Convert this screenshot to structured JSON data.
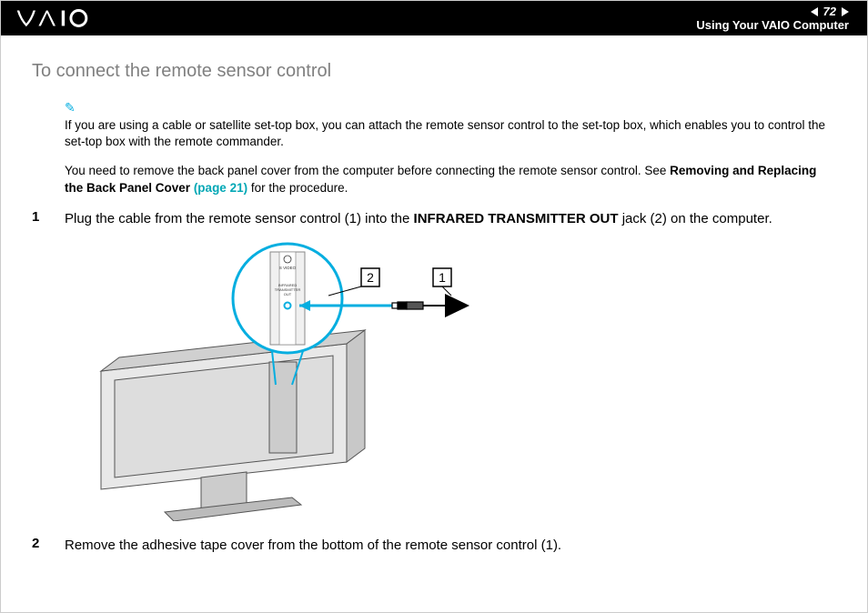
{
  "header": {
    "page_number": "72",
    "section": "Using Your VAIO Computer"
  },
  "heading": "To connect the remote sensor control",
  "note1": "If you are using a cable or satellite set-top box, you can attach the remote sensor control to the set-top box, which enables you to control the set-top box with the remote commander.",
  "note2_before": "You need to remove the back panel cover from the computer before connecting the remote sensor control. See ",
  "note2_bold": "Removing and Replacing the Back Panel Cover ",
  "note2_link": "(page 21)",
  "note2_after": " for the procedure.",
  "steps": {
    "s1_num": "1",
    "s1_before": "Plug the cable from the remote sensor control (1) into the ",
    "s1_bold": "INFRARED TRANSMITTER OUT",
    "s1_after": " jack (2) on the computer.",
    "s2_num": "2",
    "s2_text": "Remove the adhesive tape cover from the bottom of the remote sensor control (1)."
  },
  "figure": {
    "label1": "1",
    "label2": "2",
    "port_svideo": "S VIDEO",
    "port_ir1": "INFRARED",
    "port_ir2": "TRANSMITTER",
    "port_ir3": "OUT"
  }
}
